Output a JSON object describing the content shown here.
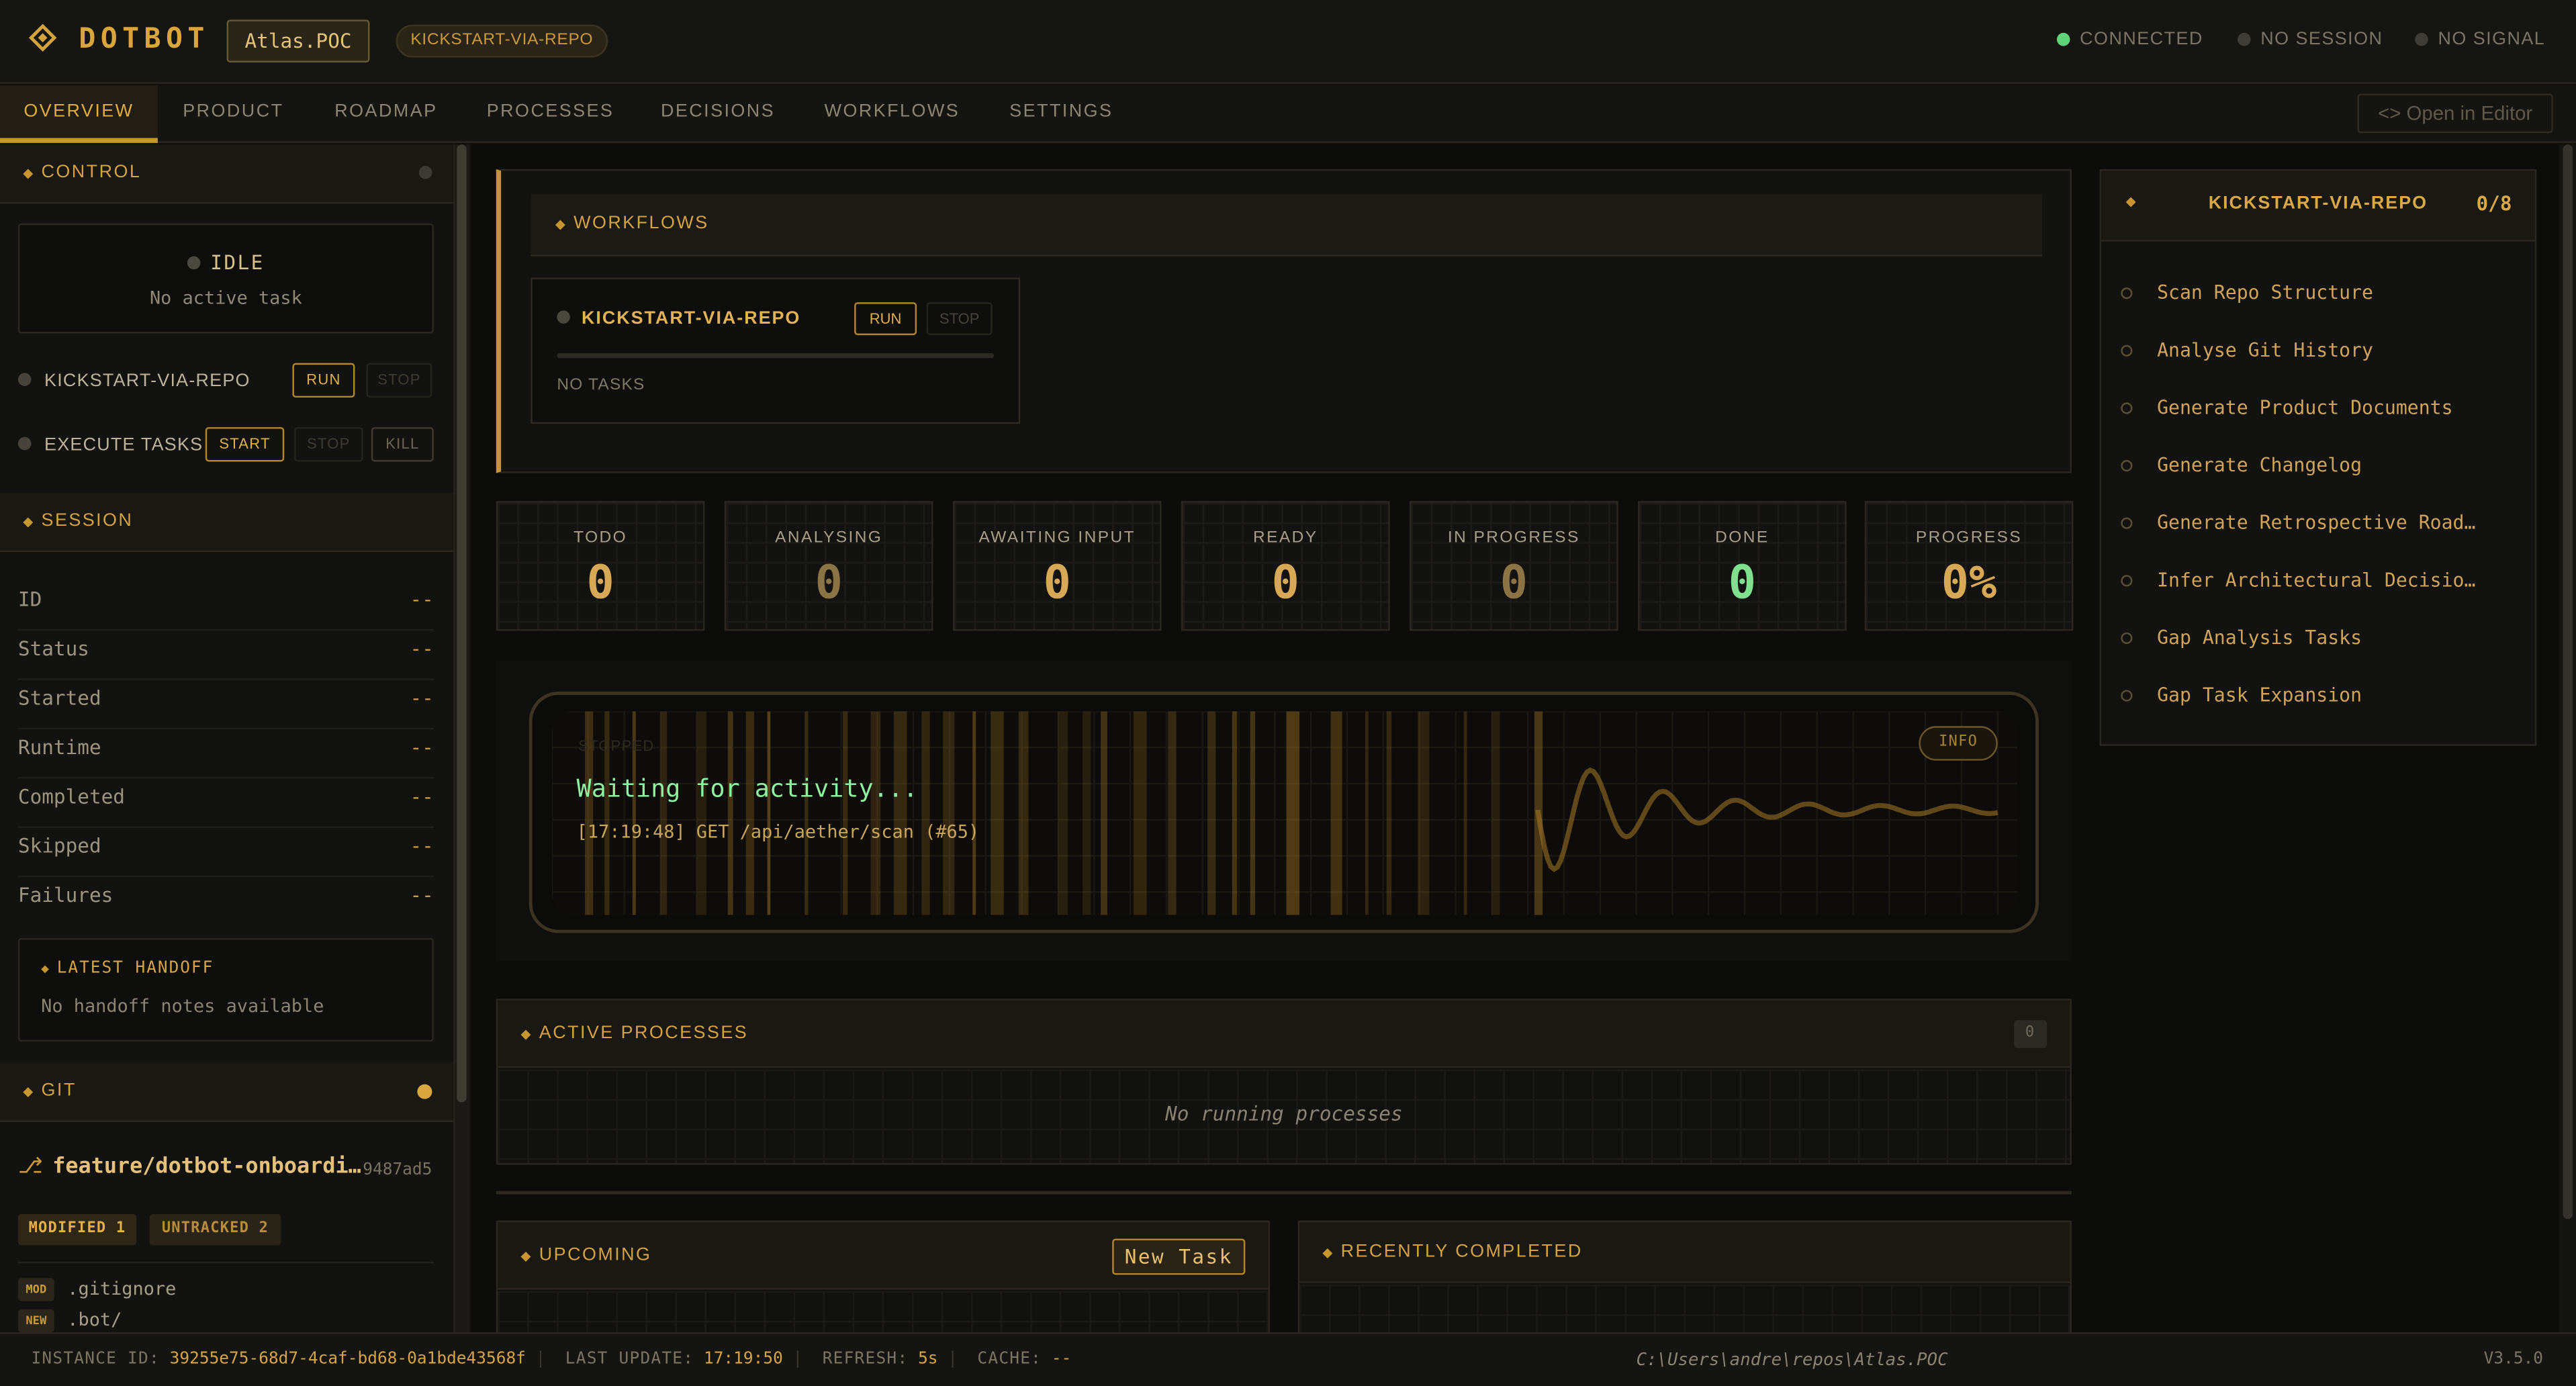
{
  "header": {
    "brand": "DOTBOT",
    "project": "Atlas.POC",
    "active_workflow": "KICKSTART-VIA-REPO",
    "status": [
      {
        "label": "CONNECTED",
        "color": "#5fd37a"
      },
      {
        "label": "NO SESSION",
        "color": "#3e3c36"
      },
      {
        "label": "NO SIGNAL",
        "color": "#3e3c36"
      }
    ]
  },
  "tabs": [
    "OVERVIEW",
    "PRODUCT",
    "ROADMAP",
    "PROCESSES",
    "DECISIONS",
    "WORKFLOWS",
    "SETTINGS"
  ],
  "open_editor": "<> Open in Editor",
  "sidebar": {
    "control": {
      "title": "CONTROL",
      "state": "IDLE",
      "state_sub": "No active task",
      "workflow_row": {
        "label": "KICKSTART-VIA-REPO",
        "run": "RUN",
        "stop": "STOP"
      },
      "exec_row": {
        "label": "EXECUTE TASKS",
        "start": "START",
        "stop": "STOP",
        "kill": "KILL"
      }
    },
    "session": {
      "title": "SESSION",
      "rows": [
        {
          "key": "ID",
          "value": "--"
        },
        {
          "key": "Status",
          "value": "--"
        },
        {
          "key": "Started",
          "value": "--"
        },
        {
          "key": "Runtime",
          "value": "--"
        },
        {
          "key": "Completed",
          "value": "--"
        },
        {
          "key": "Skipped",
          "value": "--"
        },
        {
          "key": "Failures",
          "value": "--"
        }
      ],
      "handoff_title": "LATEST HANDOFF",
      "handoff_text": "No handoff notes available"
    },
    "git": {
      "title": "GIT",
      "branch": "feature/dotbot-onboardi…",
      "commit": "9487ad5",
      "modified": "MODIFIED 1",
      "untracked": "UNTRACKED 2",
      "files": [
        {
          "tag": "MOD",
          "name": ".gitignore"
        },
        {
          "tag": "NEW",
          "name": ".bot/"
        }
      ]
    }
  },
  "workflows_panel": {
    "title": "WORKFLOWS",
    "card": {
      "name": "KICKSTART-VIA-REPO",
      "run": "RUN",
      "stop": "STOP",
      "tasks": "NO TASKS"
    }
  },
  "stats": [
    {
      "label": "TODO",
      "value": "0"
    },
    {
      "label": "ANALYSING",
      "value": "0"
    },
    {
      "label": "AWAITING INPUT",
      "value": "0"
    },
    {
      "label": "READY",
      "value": "0"
    },
    {
      "label": "IN PROGRESS",
      "value": "0"
    },
    {
      "label": "DONE",
      "value": "0"
    },
    {
      "label": "PROGRESS",
      "value": "0%"
    }
  ],
  "terminal": {
    "state": "STOPPED",
    "waiting": "Waiting for activity...",
    "log": "[17:19:48] GET /api/aether/scan (#65)",
    "badge": "INFO"
  },
  "active_processes": {
    "title": "ACTIVE PROCESSES",
    "count": "0",
    "empty": "No running processes"
  },
  "upcoming": {
    "title": "UPCOMING",
    "new_task": "New Task"
  },
  "recently_completed": {
    "title": "RECENTLY COMPLETED"
  },
  "steps_panel": {
    "title": "KICKSTART-VIA-REPO",
    "count": "0/8",
    "steps": [
      "Scan Repo Structure",
      "Analyse Git History",
      "Generate Product Documents",
      "Generate Changelog",
      "Generate Retrospective Road…",
      "Infer Architectural Decisio…",
      "Gap Analysis Tasks",
      "Gap Task Expansion"
    ]
  },
  "footer": {
    "instance_label": "INSTANCE ID:",
    "instance_id": "39255e75-68d7-4caf-bd68-0a1bde43568f",
    "update_label": "LAST UPDATE:",
    "update_time": "17:19:50",
    "refresh_label": "REFRESH:",
    "refresh_value": "5s",
    "cache_label": "CACHE:",
    "cache_value": "--",
    "path": "C:\\Users\\andre\\repos\\Atlas.POC",
    "version": "V3.5.0"
  }
}
